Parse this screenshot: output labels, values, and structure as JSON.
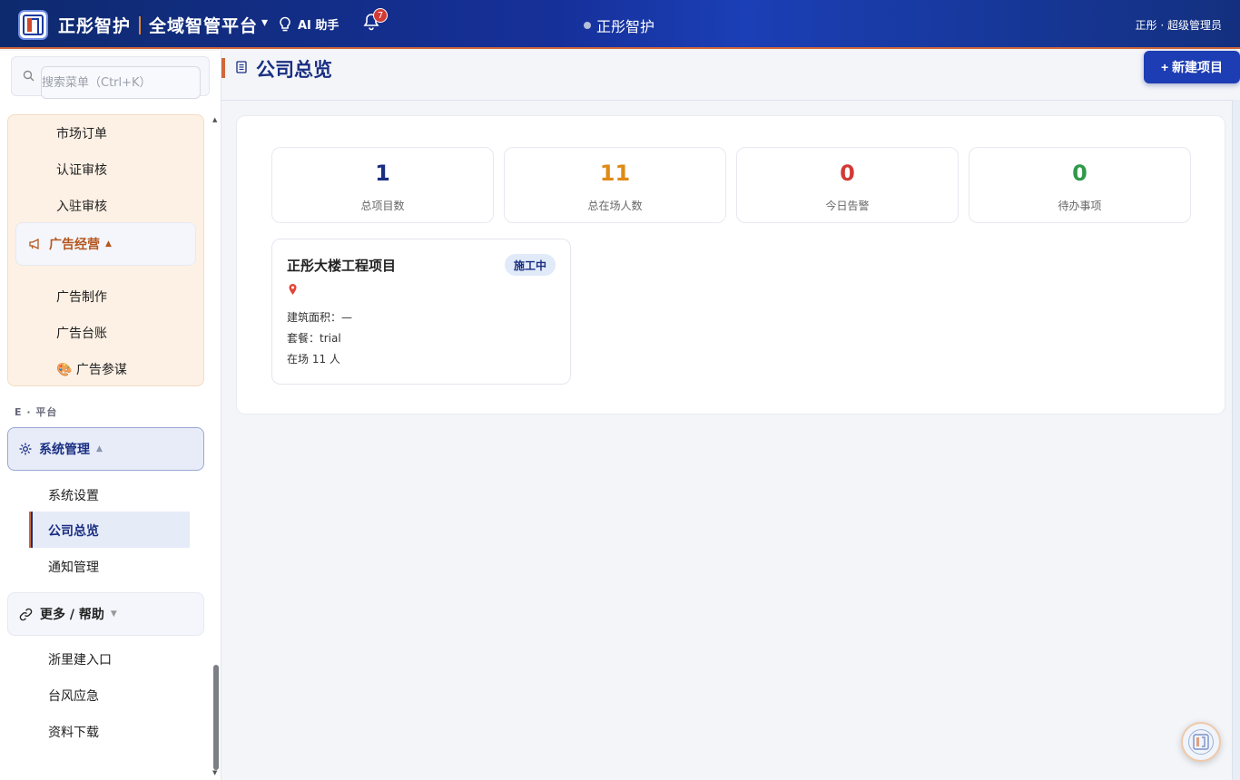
{
  "header": {
    "brand_name": "正彤智护",
    "brand_subtitle": "全域智管平台",
    "dropdown_caret": "▾",
    "ai_label": "AI 助手",
    "notification_count": "7",
    "center_title": "正彤智护",
    "user_label": "正彤 · 超级管理员"
  },
  "sidebar": {
    "search_placeholder": "搜索菜单（Ctrl+K）",
    "market_items": [
      "市场订单",
      "认证审核",
      "入驻审核"
    ],
    "ad_group": {
      "label": "广告经营",
      "arrow": "▲",
      "items": [
        "广告制作",
        "广告台账",
        "🎨 广告参谋"
      ]
    },
    "section_platform": "E · 平台",
    "system_group": {
      "label": "系统管理",
      "arrow": "▲",
      "items": [
        "系统设置",
        "公司总览",
        "通知管理"
      ],
      "active": "公司总览"
    },
    "more_group": {
      "label": "更多 / 帮助",
      "arrow": "▼",
      "items": [
        "浙里建入口",
        "台风应急",
        "资料下载"
      ]
    }
  },
  "main": {
    "page_title": "公司总览",
    "new_button": "+ 新建项目",
    "stats": [
      {
        "value": "1",
        "label": "总项目数",
        "color": "#1a2f82"
      },
      {
        "value": "11",
        "label": "总在场人数",
        "color": "#e08a17"
      },
      {
        "value": "0",
        "label": "今日告警",
        "color": "#d23a36"
      },
      {
        "value": "0",
        "label": "待办事项",
        "color": "#2e9a4a"
      }
    ],
    "project": {
      "name": "正彤大楼工程项目",
      "status": "施工中",
      "area": "建筑面积：—",
      "plan": "套餐：trial",
      "onsite": "在场 11 人"
    }
  }
}
